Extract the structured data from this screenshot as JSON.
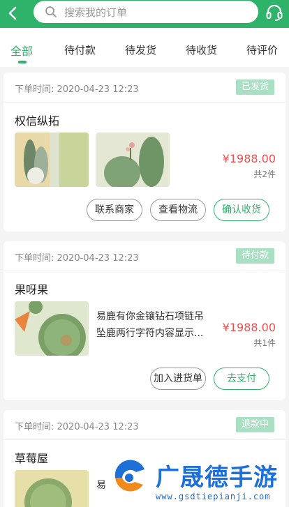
{
  "header": {
    "search_placeholder": "搜索我的订单",
    "accent": "#2fb36a"
  },
  "tabs": [
    {
      "label": "全部",
      "active": true
    },
    {
      "label": "待付款",
      "active": false
    },
    {
      "label": "待发货",
      "active": false
    },
    {
      "label": "待收货",
      "active": false
    },
    {
      "label": "待评价",
      "active": false
    }
  ],
  "orders": [
    {
      "time_label": "下单时间: 2020-04-23 12:23",
      "status": "已发货",
      "shop": "权信纵拓",
      "price": "¥1988.00",
      "count": "共2件",
      "buttons": [
        "联系商家",
        "查看物流",
        "确认收货"
      ]
    },
    {
      "time_label": "下单时间: 2020-04-23 12:23",
      "status": "待付款",
      "shop": "果呀果",
      "product_name": "易鹿有你金镶钻石项链吊坠鹿两行字符内容显示...",
      "price": "¥1988.00",
      "count": "共1件",
      "buttons": [
        "加入进货单",
        "去支付"
      ]
    },
    {
      "time_label": "下单时间: 2020-04-23 12:23",
      "status": "退款中",
      "shop": "草莓屋",
      "product_name_partial": "易"
    }
  ],
  "watermark": {
    "title": "广晟德手游",
    "url": "www.gsdtiepianji.com"
  }
}
